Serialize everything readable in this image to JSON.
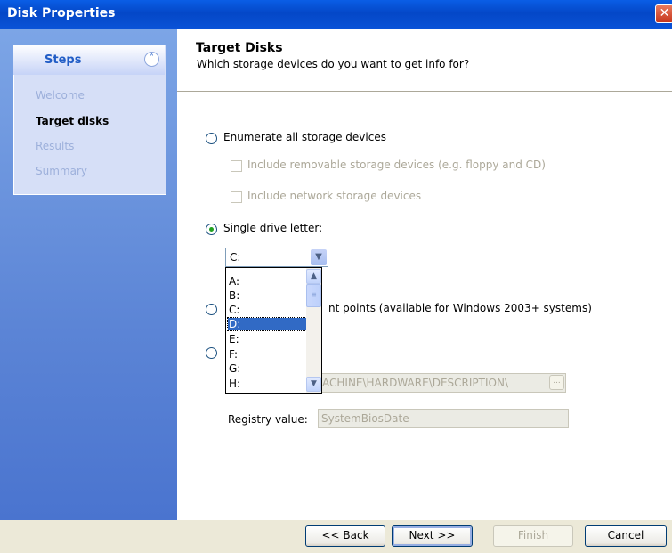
{
  "window": {
    "title": "Disk Properties",
    "close_glyph": "✕"
  },
  "sidebar": {
    "header": "Steps",
    "collapse_glyph": "˄",
    "steps": [
      {
        "label": "Welcome",
        "active": false
      },
      {
        "label": "Target disks",
        "active": true
      },
      {
        "label": "Results",
        "active": false
      },
      {
        "label": "Summary",
        "active": false
      }
    ]
  },
  "page": {
    "title": "Target Disks",
    "subtitle": "Which storage devices do you want to get info for?"
  },
  "options": {
    "enumerate_all": "Enumerate all storage devices",
    "include_removable": "Include removable storage devices (e.g. floppy and CD)",
    "include_network": "Include network storage devices",
    "single_drive": "Single drive letter:",
    "mount_points_partial": "nt points (available for Windows 2003+ systems)"
  },
  "drive_combo": {
    "value": "C:",
    "list": [
      "A:",
      "B:",
      "C:",
      "D:",
      "E:",
      "F:",
      "G:",
      "H:"
    ],
    "highlighted": "D:"
  },
  "registry": {
    "key_partial": "ACHINE\\HARDWARE\\DESCRIPTION\\",
    "ellipsis": "...",
    "value_label": "Registry value:",
    "value": "SystemBiosDate"
  },
  "buttons": {
    "back": "<< Back",
    "next": "Next >>",
    "finish": "Finish",
    "cancel": "Cancel"
  },
  "colors": {
    "title_bar": "#0A5EE6",
    "sidebar": "#6B93DC",
    "selection": "#316AC5",
    "radio_dot": "#21A121"
  }
}
